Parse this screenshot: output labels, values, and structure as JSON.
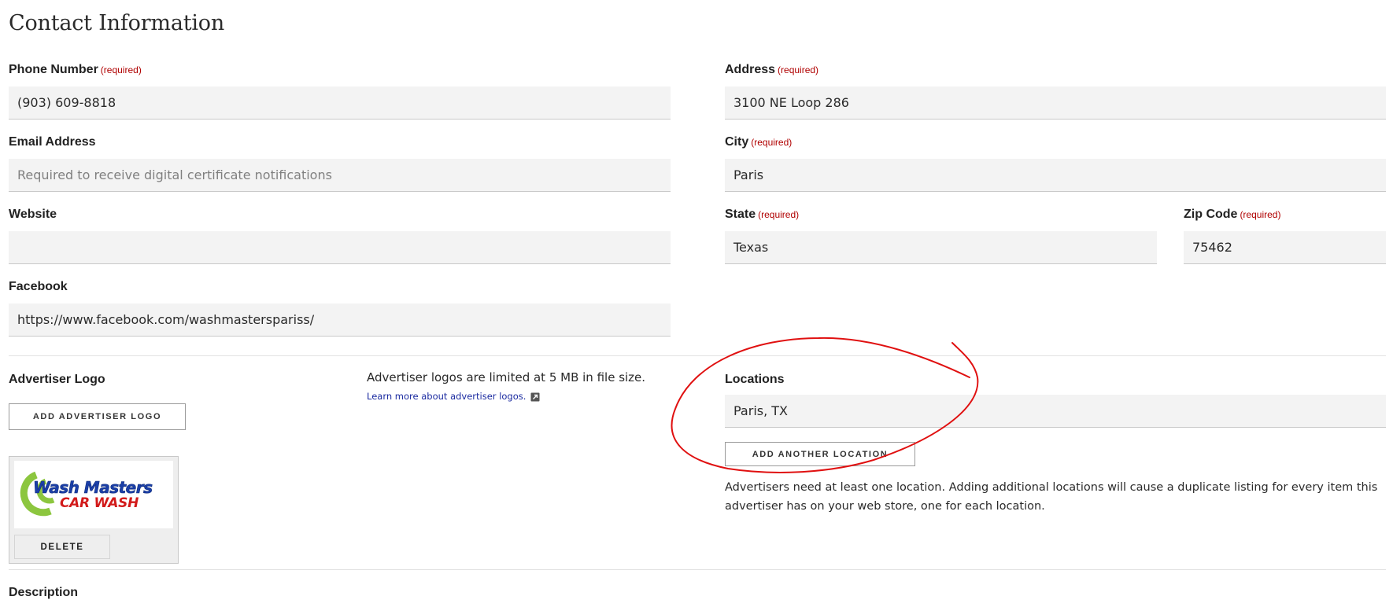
{
  "section_title": "Contact Information",
  "required_text": "(required)",
  "phone": {
    "label": "Phone Number",
    "value": "(903) 609-8818"
  },
  "email": {
    "label": "Email Address",
    "placeholder": "Required to receive digital certificate notifications"
  },
  "website": {
    "label": "Website",
    "value": ""
  },
  "facebook": {
    "label": "Facebook",
    "value": "https://www.facebook.com/washmasterspariss/"
  },
  "address": {
    "label": "Address",
    "value": "3100 NE Loop 286"
  },
  "city": {
    "label": "City",
    "value": "Paris"
  },
  "state": {
    "label": "State",
    "value": "Texas"
  },
  "zip": {
    "label": "Zip Code",
    "value": "75462"
  },
  "logo": {
    "label": "Advertiser Logo",
    "add_button": "ADD ADVERTISER LOGO",
    "size_note": "Advertiser logos are limited at 5 MB in file size.",
    "learn_more": "Learn more about advertiser logos.",
    "image_line1": "Wash Masters",
    "image_line2": "CAR WASH",
    "delete_button": "DELETE"
  },
  "locations": {
    "label": "Locations",
    "value": "Paris, TX",
    "add_button": "ADD ANOTHER LOCATION",
    "help": "Advertisers need at least one location. Adding additional locations will cause a duplicate listing for every item this advertiser has on your web store, one for each location."
  },
  "description": {
    "label": "Description"
  },
  "colors": {
    "required": "#b00000",
    "annotation": "#e01010",
    "logo_blue": "#1b3fa8",
    "logo_red": "#d21a1a",
    "logo_green": "#8cc63f"
  },
  "icons": {
    "external_link": "external-link-icon"
  }
}
